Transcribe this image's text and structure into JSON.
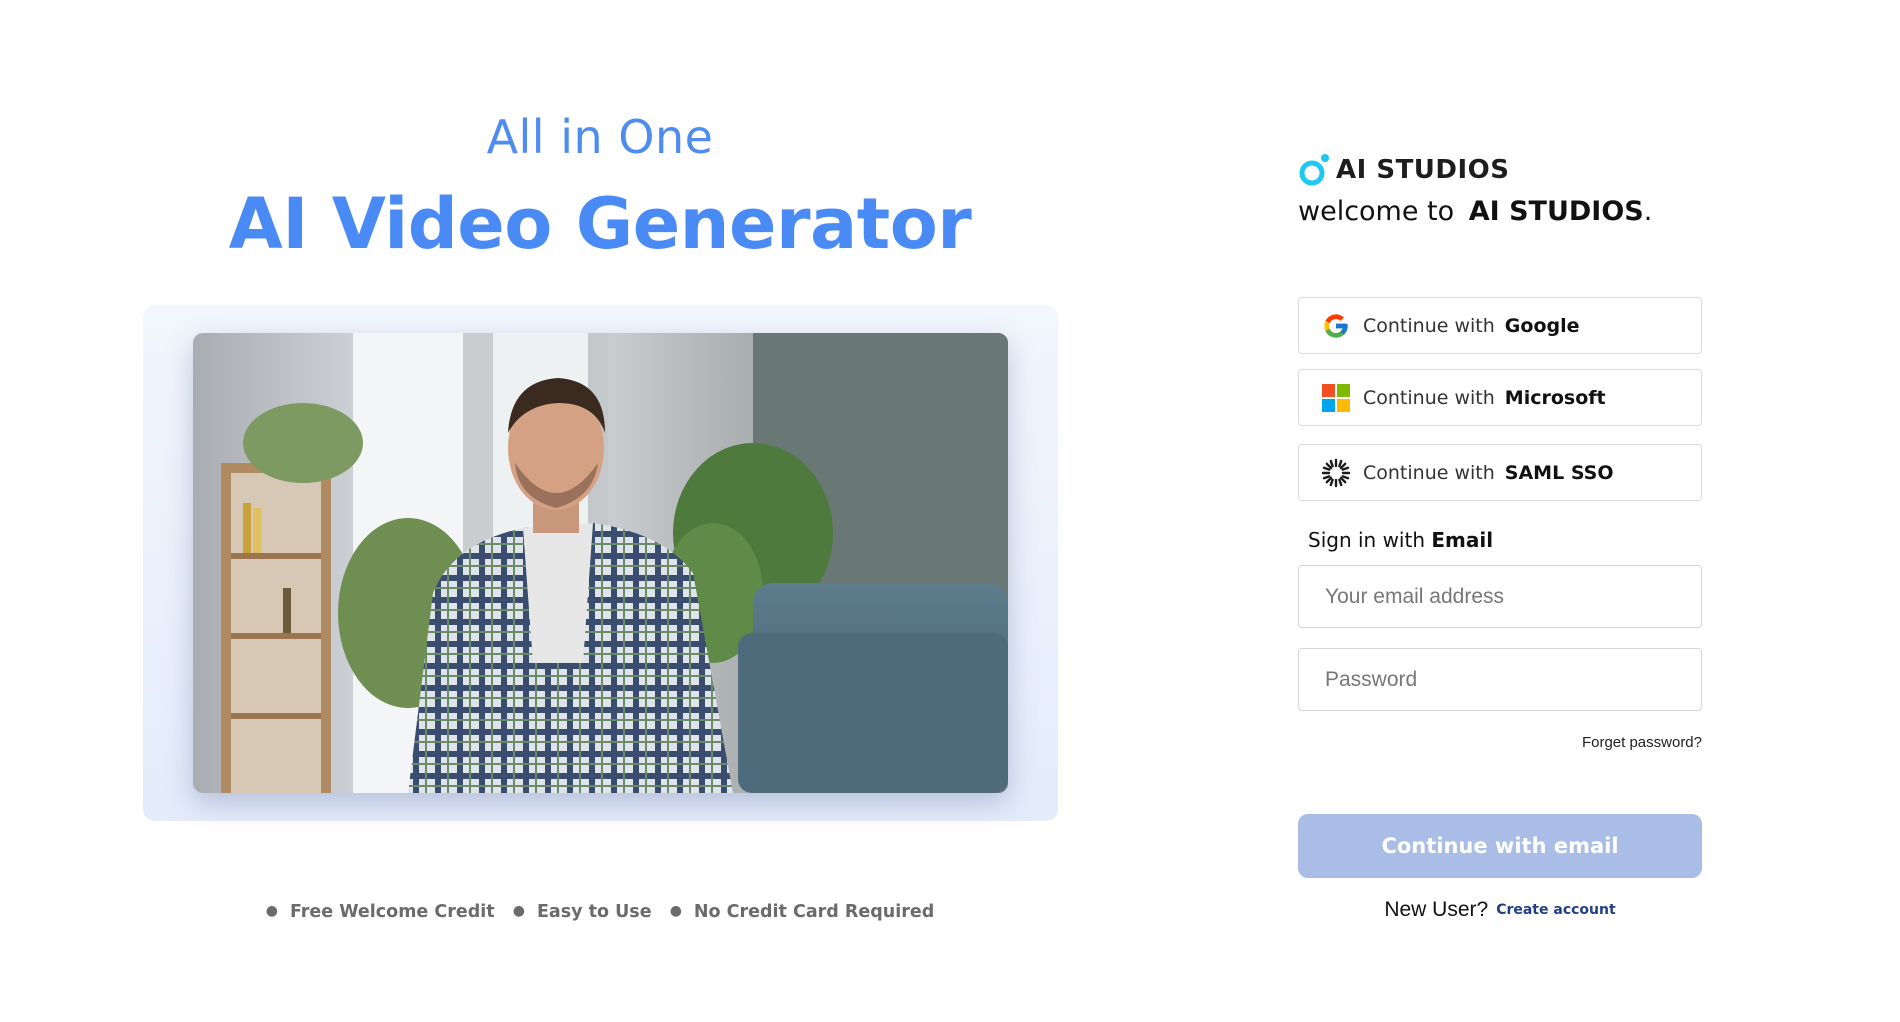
{
  "promo": {
    "subheading": "All in One",
    "headline": "AI Video Generator",
    "features": [
      "Free Welcome Credit",
      "Easy to Use",
      "No Credit Card Required"
    ]
  },
  "brand": {
    "name": "AI STUDIOS",
    "welcome_prefix": "welcome to",
    "welcome_brand": "AI STUDIOS",
    "welcome_suffix": "."
  },
  "sso": [
    {
      "prefix": "Continue with",
      "provider": "Google",
      "icon": "google-icon"
    },
    {
      "prefix": "Continue with",
      "provider": "Microsoft",
      "icon": "microsoft-icon"
    },
    {
      "prefix": "Continue with",
      "provider": "SAML SSO",
      "icon": "saml-sso-icon"
    }
  ],
  "email_section": {
    "label_prefix": "Sign in with",
    "label_bold": "Email",
    "email_placeholder": "Your email address",
    "email_value": "",
    "password_placeholder": "Password",
    "password_value": "",
    "forgot": "Forget password?",
    "continue": "Continue with email",
    "new_user": "New User?",
    "create_account": "Create account"
  },
  "colors": {
    "accent": "#4a8af4",
    "continue_disabled": "#a9bde6",
    "link": "#1f3f86",
    "brand_cyan": "#1ec8f0"
  }
}
